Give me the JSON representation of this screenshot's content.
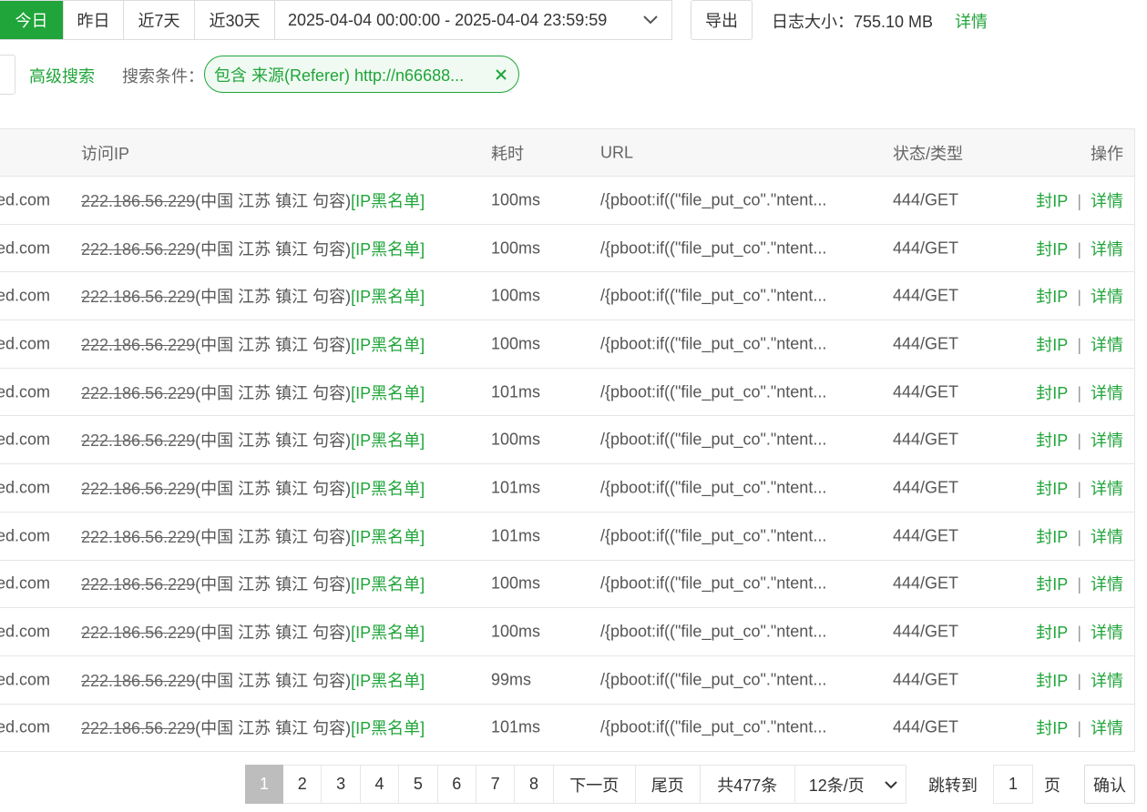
{
  "toolbar": {
    "date_tabs": [
      {
        "label": "今日",
        "active": true
      },
      {
        "label": "昨日",
        "active": false
      },
      {
        "label": "近7天",
        "active": false
      },
      {
        "label": "近30天",
        "active": false
      }
    ],
    "date_range": "2025-04-04 00:00:00 - 2025-04-04 23:59:59",
    "export_label": "导出",
    "log_size_text": "日志大小：755.10 MB",
    "detail_label": "详情"
  },
  "search": {
    "advanced_label": "高级搜索",
    "condition_label": "搜索条件：",
    "condition_tag": "包含 来源(Referer) http://n66688..."
  },
  "table": {
    "headers": {
      "ip": "访问IP",
      "time": "耗时",
      "url": "URL",
      "status": "状态/类型",
      "ops": "操作"
    },
    "rows": [
      {
        "host": "ed.com",
        "ip": "222.186.56.229",
        "location": "(中国 江苏 镇江 句容)",
        "tag": "[IP黑名单]",
        "time": "100ms",
        "url": "/{pboot:if((\"file_put_co\".\"ntent...",
        "status": "444/GET"
      },
      {
        "host": "ed.com",
        "ip": "222.186.56.229",
        "location": "(中国 江苏 镇江 句容)",
        "tag": "[IP黑名单]",
        "time": "100ms",
        "url": "/{pboot:if((\"file_put_co\".\"ntent...",
        "status": "444/GET"
      },
      {
        "host": "ed.com",
        "ip": "222.186.56.229",
        "location": "(中国 江苏 镇江 句容)",
        "tag": "[IP黑名单]",
        "time": "100ms",
        "url": "/{pboot:if((\"file_put_co\".\"ntent...",
        "status": "444/GET"
      },
      {
        "host": "ed.com",
        "ip": "222.186.56.229",
        "location": "(中国 江苏 镇江 句容)",
        "tag": "[IP黑名单]",
        "time": "100ms",
        "url": "/{pboot:if((\"file_put_co\".\"ntent...",
        "status": "444/GET"
      },
      {
        "host": "ed.com",
        "ip": "222.186.56.229",
        "location": "(中国 江苏 镇江 句容)",
        "tag": "[IP黑名单]",
        "time": "101ms",
        "url": "/{pboot:if((\"file_put_co\".\"ntent...",
        "status": "444/GET"
      },
      {
        "host": "ed.com",
        "ip": "222.186.56.229",
        "location": "(中国 江苏 镇江 句容)",
        "tag": "[IP黑名单]",
        "time": "100ms",
        "url": "/{pboot:if((\"file_put_co\".\"ntent...",
        "status": "444/GET"
      },
      {
        "host": "ed.com",
        "ip": "222.186.56.229",
        "location": "(中国 江苏 镇江 句容)",
        "tag": "[IP黑名单]",
        "time": "101ms",
        "url": "/{pboot:if((\"file_put_co\".\"ntent...",
        "status": "444/GET"
      },
      {
        "host": "ed.com",
        "ip": "222.186.56.229",
        "location": "(中国 江苏 镇江 句容)",
        "tag": "[IP黑名单]",
        "time": "101ms",
        "url": "/{pboot:if((\"file_put_co\".\"ntent...",
        "status": "444/GET"
      },
      {
        "host": "ed.com",
        "ip": "222.186.56.229",
        "location": "(中国 江苏 镇江 句容)",
        "tag": "[IP黑名单]",
        "time": "100ms",
        "url": "/{pboot:if((\"file_put_co\".\"ntent...",
        "status": "444/GET"
      },
      {
        "host": "ed.com",
        "ip": "222.186.56.229",
        "location": "(中国 江苏 镇江 句容)",
        "tag": "[IP黑名单]",
        "time": "100ms",
        "url": "/{pboot:if((\"file_put_co\".\"ntent...",
        "status": "444/GET"
      },
      {
        "host": "ed.com",
        "ip": "222.186.56.229",
        "location": "(中国 江苏 镇江 句容)",
        "tag": "[IP黑名单]",
        "time": "99ms",
        "url": "/{pboot:if((\"file_put_co\".\"ntent...",
        "status": "444/GET"
      },
      {
        "host": "ed.com",
        "ip": "222.186.56.229",
        "location": "(中国 江苏 镇江 句容)",
        "tag": "[IP黑名单]",
        "time": "101ms",
        "url": "/{pboot:if((\"file_put_co\".\"ntent...",
        "status": "444/GET"
      }
    ],
    "ops": {
      "block_ip": "封IP",
      "separator": "|",
      "detail": "详情"
    }
  },
  "pagination": {
    "pages": [
      "1",
      "2",
      "3",
      "4",
      "5",
      "6",
      "7",
      "8"
    ],
    "current": "1",
    "next_label": "下一页",
    "last_label": "尾页",
    "total_text": "共477条",
    "per_page": "12条/页",
    "jump_label": "跳转到",
    "jump_value": "1",
    "jump_unit": "页",
    "confirm_label": "确认"
  },
  "colors": {
    "accent": "#20a53a",
    "active_page": "#bdbdbd",
    "border": "#e6e6e6"
  }
}
